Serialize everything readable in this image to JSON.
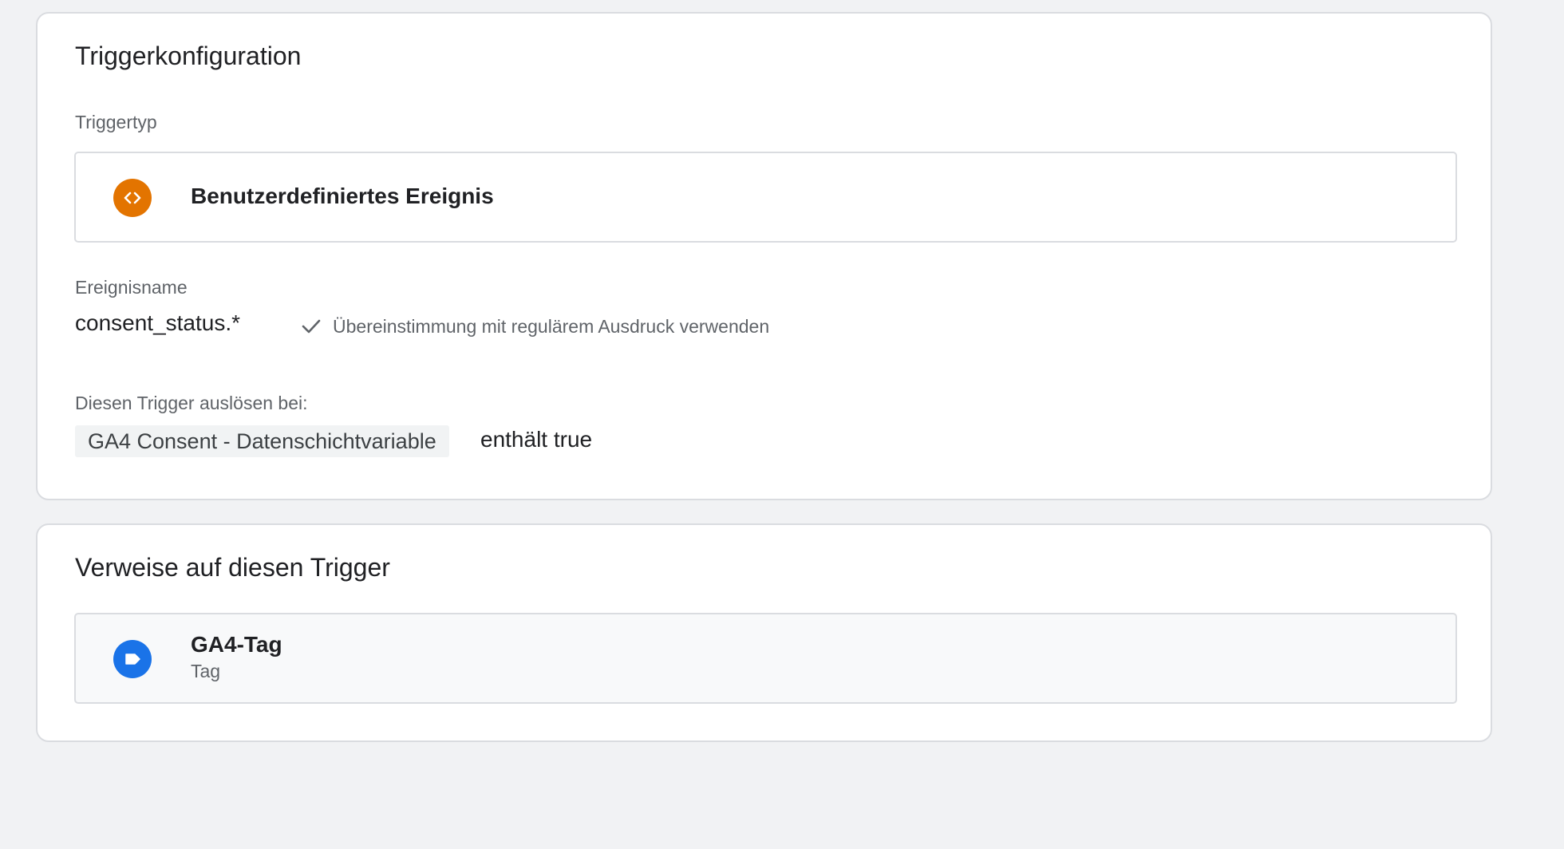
{
  "config_card": {
    "title": "Triggerkonfiguration",
    "trigger_type_label": "Triggertyp",
    "trigger_type": {
      "name": "Benutzerdefiniertes Ereignis",
      "icon": "code-brackets-icon",
      "icon_color": "#e37400"
    },
    "event_name_label": "Ereignisname",
    "event_name_value": "consent_status.*",
    "regex_option": {
      "icon": "checkmark-icon",
      "label": "Übereinstimmung mit regulärem Ausdruck verwenden"
    },
    "fire_on_label": "Diesen Trigger auslösen bei:",
    "condition": {
      "variable": "GA4 Consent - Datenschichtvariable",
      "operator_value": "enthält true"
    }
  },
  "refs_card": {
    "title": "Verweise auf diesen Trigger",
    "items": [
      {
        "name": "GA4-Tag",
        "type": "Tag",
        "icon": "tag-label-icon",
        "icon_color": "#1a73e8"
      }
    ]
  }
}
